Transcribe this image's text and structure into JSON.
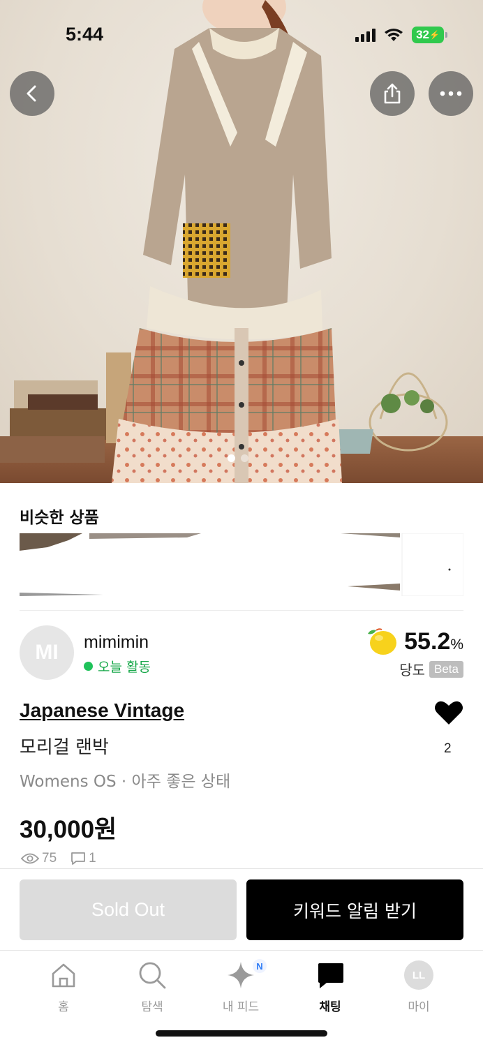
{
  "status_bar": {
    "time": "5:44",
    "battery": "32"
  },
  "similar": {
    "title": "비슷한 상품"
  },
  "seller": {
    "avatar_initials": "MI",
    "name": "mimimin",
    "activity": "오늘 활동",
    "activity_color": "#1fc25a",
    "sweetness_value": "55.2",
    "sweetness_unit": "%",
    "sweetness_label": "당도",
    "beta_badge": "Beta"
  },
  "product": {
    "brand": "Japanese Vintage",
    "name": "모리걸 랜박",
    "meta": "Womens OS · 아주 좋은 상태",
    "price": "30,000원",
    "likes": "2",
    "views": "75",
    "comments": "1",
    "image_count": 2,
    "image_index": 1
  },
  "actions": {
    "sold_out_label": "Sold Out",
    "keyword_alert_label": "키워드 알림 받기"
  },
  "tabbar": {
    "items": [
      {
        "label": "홈",
        "icon": "home-icon"
      },
      {
        "label": "탐색",
        "icon": "search-icon"
      },
      {
        "label": "내 피드",
        "icon": "sparkle-icon",
        "badge": "N"
      },
      {
        "label": "채팅",
        "icon": "chat-icon",
        "active": true
      },
      {
        "label": "마이",
        "icon": "profile-avatar",
        "initials": "LL"
      }
    ]
  },
  "colors": {
    "accent_green": "#1fc25a",
    "primary_button": "#000000",
    "disabled_button": "#dcdcdc",
    "battery_green": "#30c94d"
  }
}
